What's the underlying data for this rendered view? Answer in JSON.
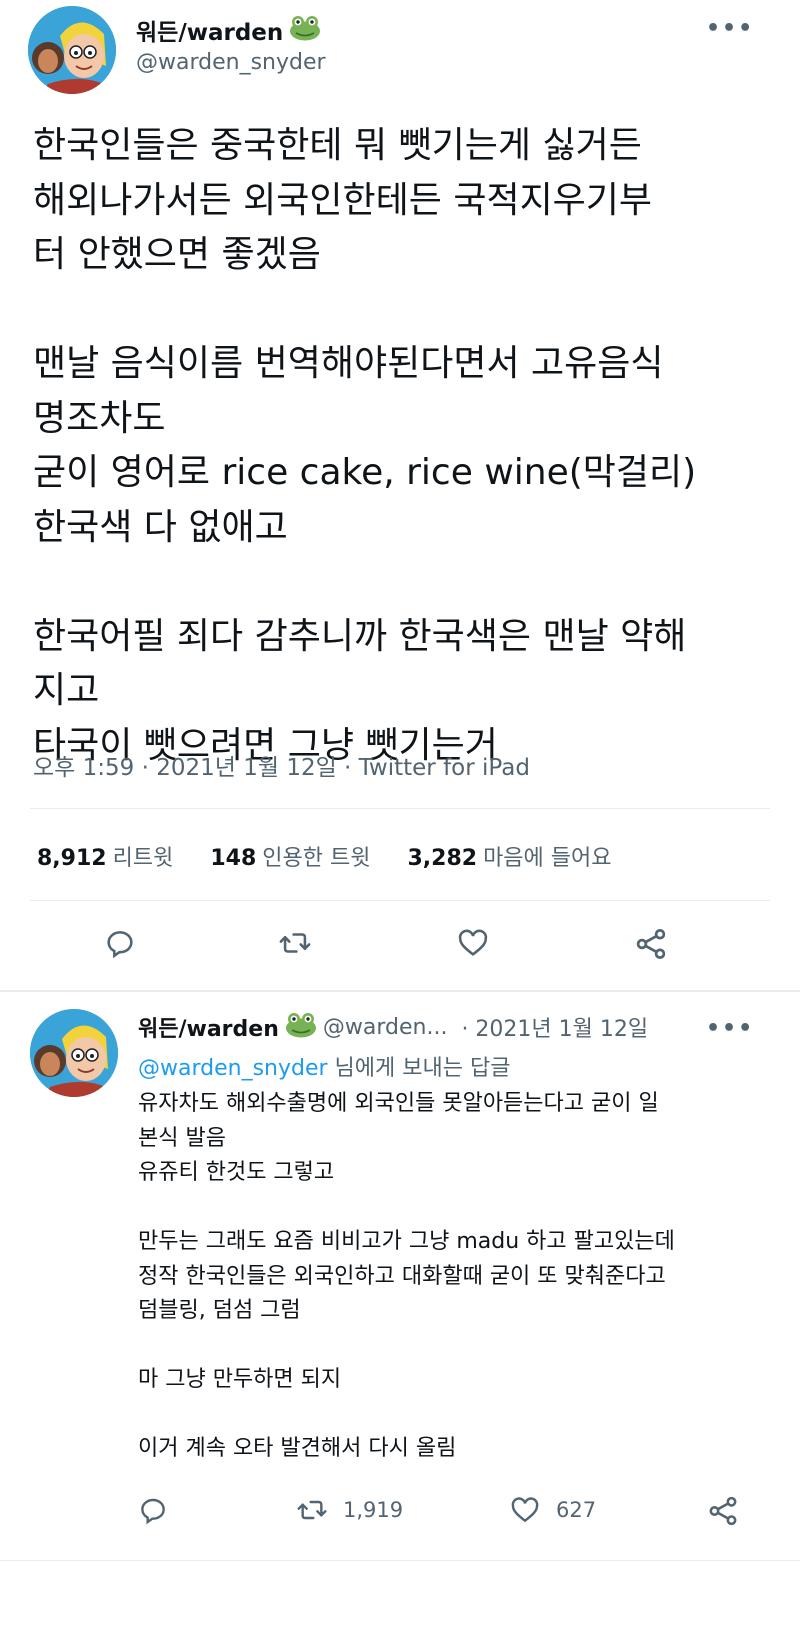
{
  "tweet": {
    "display_name": "워든/warden",
    "handle": "@warden_snyder",
    "more_label": "•••",
    "text": "한국인들은 중국한테 뭐 뺏기는게 싫거든\n해외나가서든 외국인한테든 국적지우기부\n터 안했으면 좋겠음\n\n맨날 음식이름 번역해야된다면서 고유음식\n명조차도\n굳이 영어로 rice cake, rice wine(막걸리)\n한국색 다 없애고\n\n한국어필 죄다 감추니까 한국색은 맨날 약해\n지고\n타국이 뺏으려면 그냥 뺏기는거",
    "meta": "오후 1:59 · 2021년 1월 12일 · Twitter for iPad",
    "stats": [
      {
        "value": "8,912",
        "label": "리트윗"
      },
      {
        "value": "148",
        "label": "인용한 트윗"
      },
      {
        "value": "3,282",
        "label": "마음에 들어요"
      }
    ],
    "actions": {
      "reply_icon": "reply-icon",
      "retweet_icon": "retweet-icon",
      "like_icon": "heart-icon",
      "share_icon": "share-icon"
    }
  },
  "reply": {
    "display_name": "워든/warden",
    "handle_truncated": "@warden...",
    "date": "· 2021년 1월 12일",
    "more_label": "•••",
    "replying_to_handle": "@warden_snyder",
    "replying_to_suffix": " 님에게 보내는 답글",
    "text": "유자차도 해외수출명에 외국인들 못알아듣는다고 굳이 일\n본식 발음\n유쥬티 한것도 그렇고\n\n만두는 그래도 요즘 비비고가 그냥 madu 하고 팔고있는데\n정작 한국인들은 외국인하고 대화할때 굳이 또 맞춰준다고\n덤블링, 덤섬  그럼\n\n마 그냥 만두하면 되지\n\n이거 계속 오타 발견해서 다시 올림",
    "retweet_count": "1,919",
    "like_count": "627"
  },
  "colors": {
    "text": "#0f1419",
    "secondary": "#536471",
    "link": "#1d9bf0",
    "divider": "#e6ecf0"
  }
}
